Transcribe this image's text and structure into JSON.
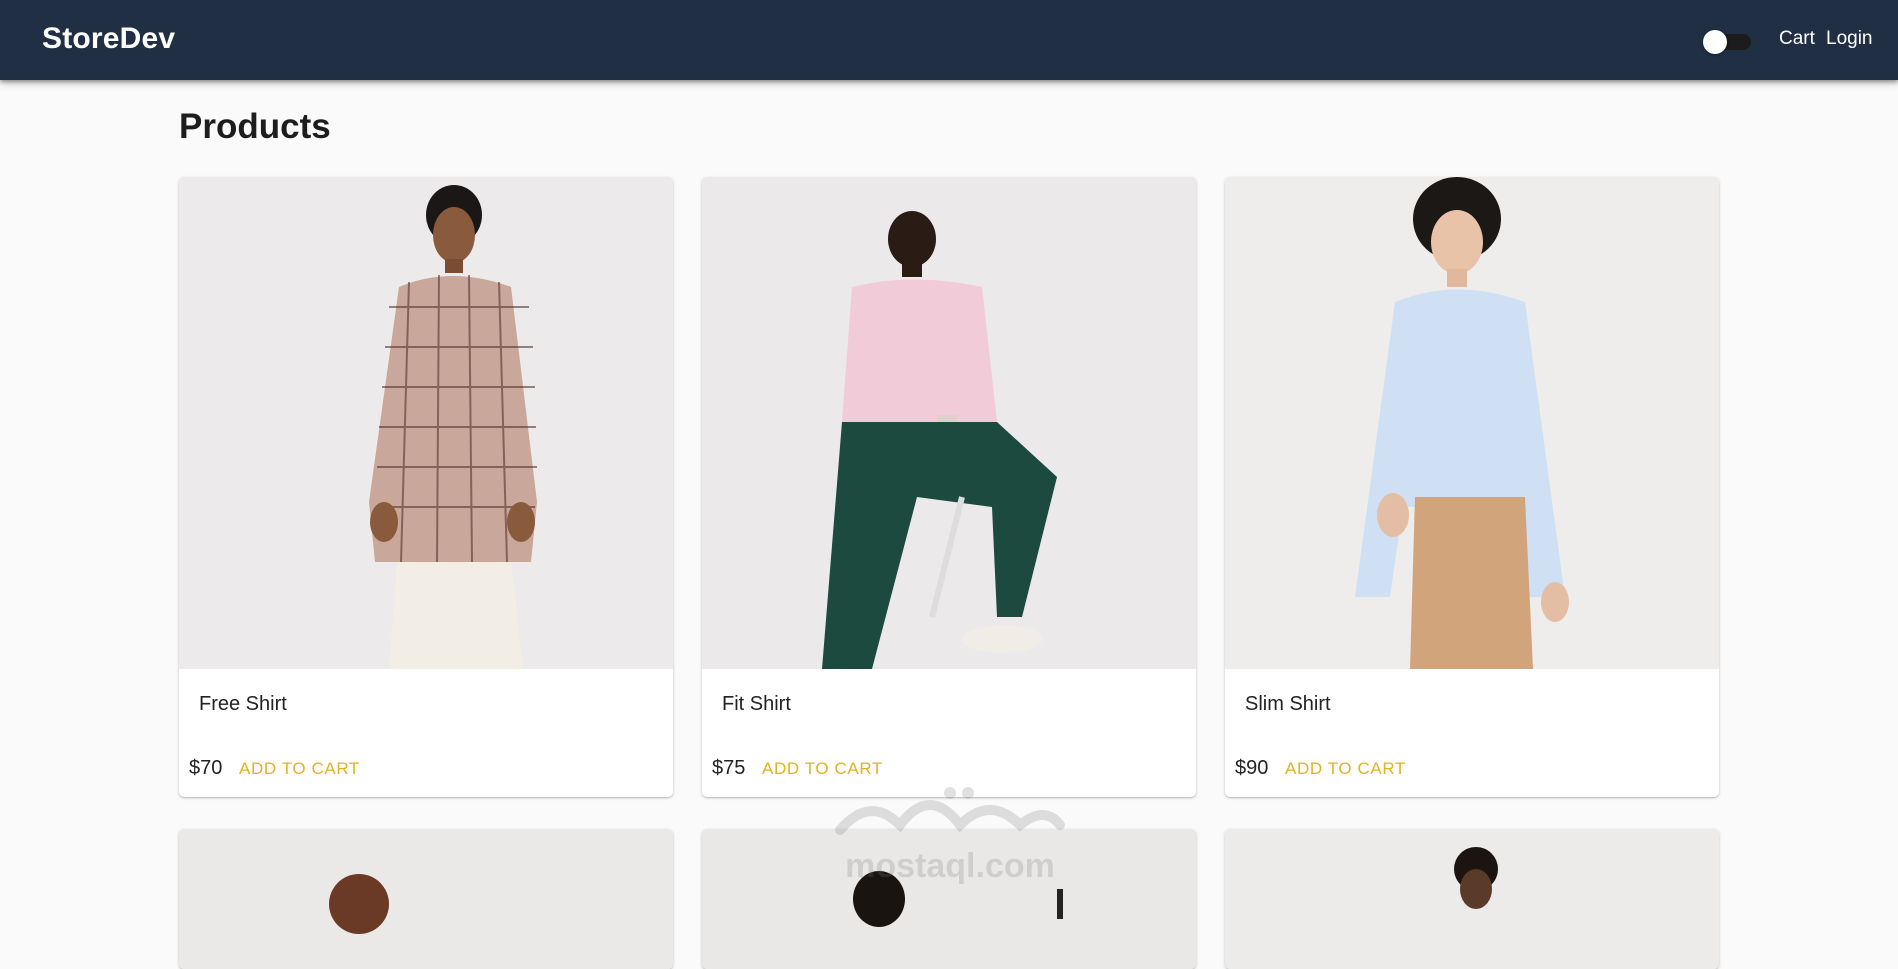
{
  "header": {
    "brand": "StoreDev",
    "theme_toggle": {
      "checked": false
    },
    "nav": {
      "cart": "Cart",
      "login": "Login"
    }
  },
  "page": {
    "title": "Products"
  },
  "products": [
    {
      "title": "Free Shirt",
      "price": "$70",
      "action": "ADD TO CART",
      "shirt_color": "#c9a79a"
    },
    {
      "title": "Fit Shirt",
      "price": "$75",
      "action": "ADD TO CART",
      "shirt_color": "#f1cbd8"
    },
    {
      "title": "Slim Shirt",
      "price": "$90",
      "action": "ADD TO CART",
      "shirt_color": "#cfe0f5"
    }
  ],
  "watermark": {
    "text": "mostaql.com"
  },
  "colors": {
    "appbar": "#212f44",
    "accent": "#e3b21f",
    "background": "#fafafa"
  }
}
